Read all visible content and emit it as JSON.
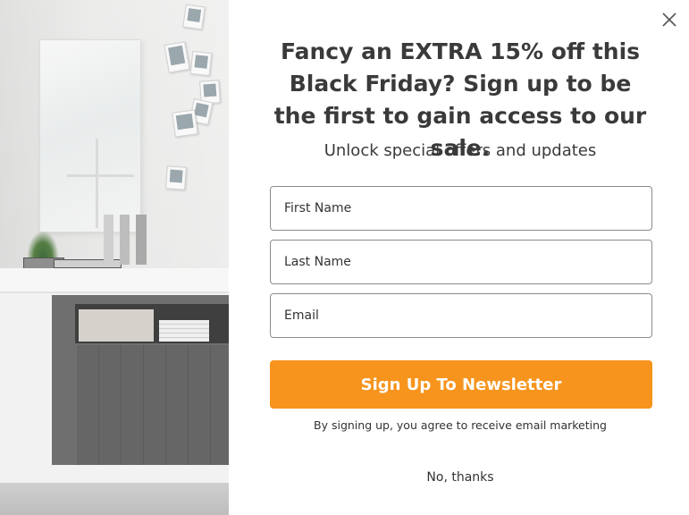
{
  "popup": {
    "headline": "Fancy an EXTRA 15% off this Black Friday? Sign up to be the first to gain access to our sale.",
    "subheadline": "Unlock special offers and updates",
    "fields": {
      "first_name_placeholder": "First Name",
      "last_name_placeholder": "Last Name",
      "email_placeholder": "Email"
    },
    "submit_label": "Sign Up To Newsletter",
    "consent_text": "By signing up, you agree to receive email marketing",
    "decline_label": "No, thanks"
  },
  "colors": {
    "accent": "#f7941d",
    "text": "#3a3a3a",
    "background": "#ffffff"
  },
  "icons": {
    "close": "close-icon"
  }
}
